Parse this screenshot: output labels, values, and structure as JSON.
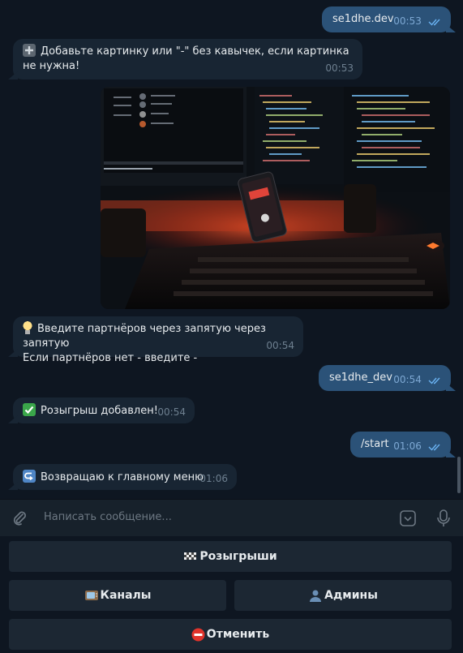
{
  "messages": [
    {
      "id": "m1",
      "direction": "out",
      "text": "se1dhe.dev",
      "time": "00:53",
      "read": true
    },
    {
      "id": "m2",
      "direction": "in",
      "emoji": "heavy-plus-sign",
      "text": "Добавьте картинку или \"-\" без кавычек, если картинка не нужна!",
      "time": "00:53"
    },
    {
      "id": "m3",
      "direction": "out",
      "type": "photo",
      "description": "desk-setup-photo"
    },
    {
      "id": "m4",
      "direction": "in",
      "emoji": "light-bulb",
      "text_line1": "Введите партнёров через запятую через запятую",
      "text_line2": "Если партнёров нет - введите -",
      "time": "00:54"
    },
    {
      "id": "m5",
      "direction": "out",
      "text": "se1dhe_dev",
      "time": "00:54",
      "read": true
    },
    {
      "id": "m6",
      "direction": "in",
      "emoji": "check-mark-button",
      "text": "Розыгрыш добавлен!",
      "time": "00:54"
    },
    {
      "id": "m7",
      "direction": "out",
      "text": "/start",
      "time": "01:06",
      "read": true
    },
    {
      "id": "m8",
      "direction": "in",
      "emoji": "return-arrow",
      "text": "Возвращаю к главному меню",
      "time": "01:06"
    }
  ],
  "composer": {
    "placeholder": "Написать сообщение...",
    "icons": [
      "paperclip-icon",
      "keyboard-toggle-icon",
      "microphone-icon"
    ]
  },
  "keyboard": {
    "rows": [
      [
        {
          "emoji": "chequered-flag",
          "label": "Розыгрыши"
        }
      ],
      [
        {
          "emoji": "television",
          "label": "Каналы"
        },
        {
          "emoji": "bust-in-silhouette",
          "label": "Админы"
        }
      ],
      [
        {
          "emoji": "no-entry",
          "label": "Отменить"
        }
      ]
    ]
  },
  "colors": {
    "background": "#0e1621",
    "incoming_bubble": "#182533",
    "outgoing_bubble": "#2b5278",
    "panel": "#17212b",
    "keyboard_button": "#1c2733",
    "read_ticks": "#6ab2f2"
  }
}
